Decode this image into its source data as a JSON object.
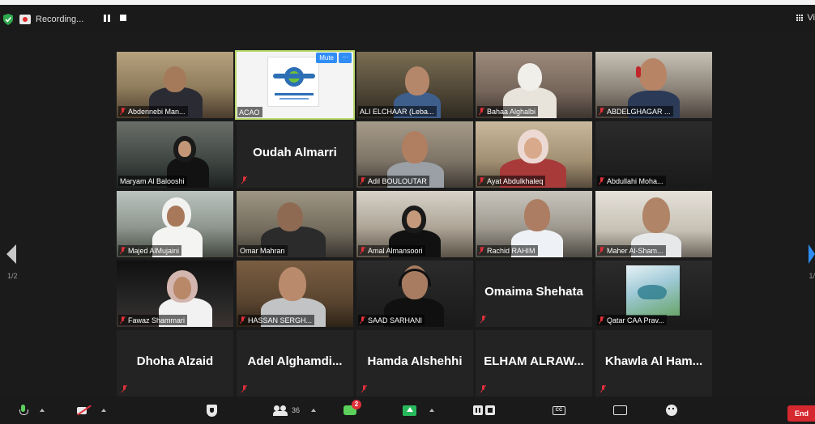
{
  "topbar": {
    "recording_label": "Recording...",
    "view_label": "Vi"
  },
  "gallery": {
    "page_indicator_left": "1/2",
    "page_indicator_right": "1/",
    "tiles": [
      {
        "name": "Abdennebi Man...",
        "muted": true,
        "video": true
      },
      {
        "name": "ACAO",
        "muted": false,
        "video": true,
        "active_speaker": true,
        "mute_button": "Mute",
        "more_button": "···"
      },
      {
        "name": "ALI ELCHAAR (Leba...",
        "muted": false,
        "video": true
      },
      {
        "name": "Bahaa Alghalbi",
        "muted": true,
        "video": true
      },
      {
        "name": "ABDELGHAGAR ...",
        "muted": true,
        "video": true
      },
      {
        "name": "Maryam Al Balooshi",
        "muted": false,
        "video": true
      },
      {
        "name": "Oudah Almarri",
        "muted": true,
        "video": false
      },
      {
        "name": "Adil BOULOUTAR",
        "muted": true,
        "video": true
      },
      {
        "name": "Ayat Abdulkhaleq",
        "muted": true,
        "video": true
      },
      {
        "name": "Abdullahi Moha...",
        "muted": true,
        "video": true
      },
      {
        "name": "Majed AlMujaini",
        "muted": true,
        "video": true
      },
      {
        "name": "Omar Mahran",
        "muted": false,
        "video": true
      },
      {
        "name": "Amal Almansoori",
        "muted": true,
        "video": true
      },
      {
        "name": "Rachid RAHIM",
        "muted": true,
        "video": true
      },
      {
        "name": "Maher Al-Sham...",
        "muted": true,
        "video": true
      },
      {
        "name": "Fawaz Shammari",
        "muted": true,
        "video": true
      },
      {
        "name": "HASSAN SERGH...",
        "muted": true,
        "video": true
      },
      {
        "name": "SAAD SARHANI",
        "muted": true,
        "video": true
      },
      {
        "name": "Omaima Shehata",
        "muted": true,
        "video": false
      },
      {
        "name": "Qatar CAA Prav...",
        "muted": true,
        "video": true
      },
      {
        "name": "Dhoha Alzaid",
        "muted": true,
        "video": false
      },
      {
        "name": "Adel  Alghamdi...",
        "muted": true,
        "video": false
      },
      {
        "name": "Hamda Alshehhi",
        "muted": true,
        "video": false
      },
      {
        "name": "ELHAM  ALRAW...",
        "muted": true,
        "video": false
      },
      {
        "name": "Khawla  Al  Ham...",
        "muted": true,
        "video": false
      }
    ]
  },
  "toolbar": {
    "participants_count": "36",
    "chat_badge": "2",
    "cc_label": "CC",
    "end_label": "End"
  },
  "colors": {
    "accent_blue": "#2f8df5",
    "active_outline": "#b8d86a",
    "muted_red": "#e0303a",
    "end_red": "#d6282f",
    "share_green": "#27b85c"
  }
}
